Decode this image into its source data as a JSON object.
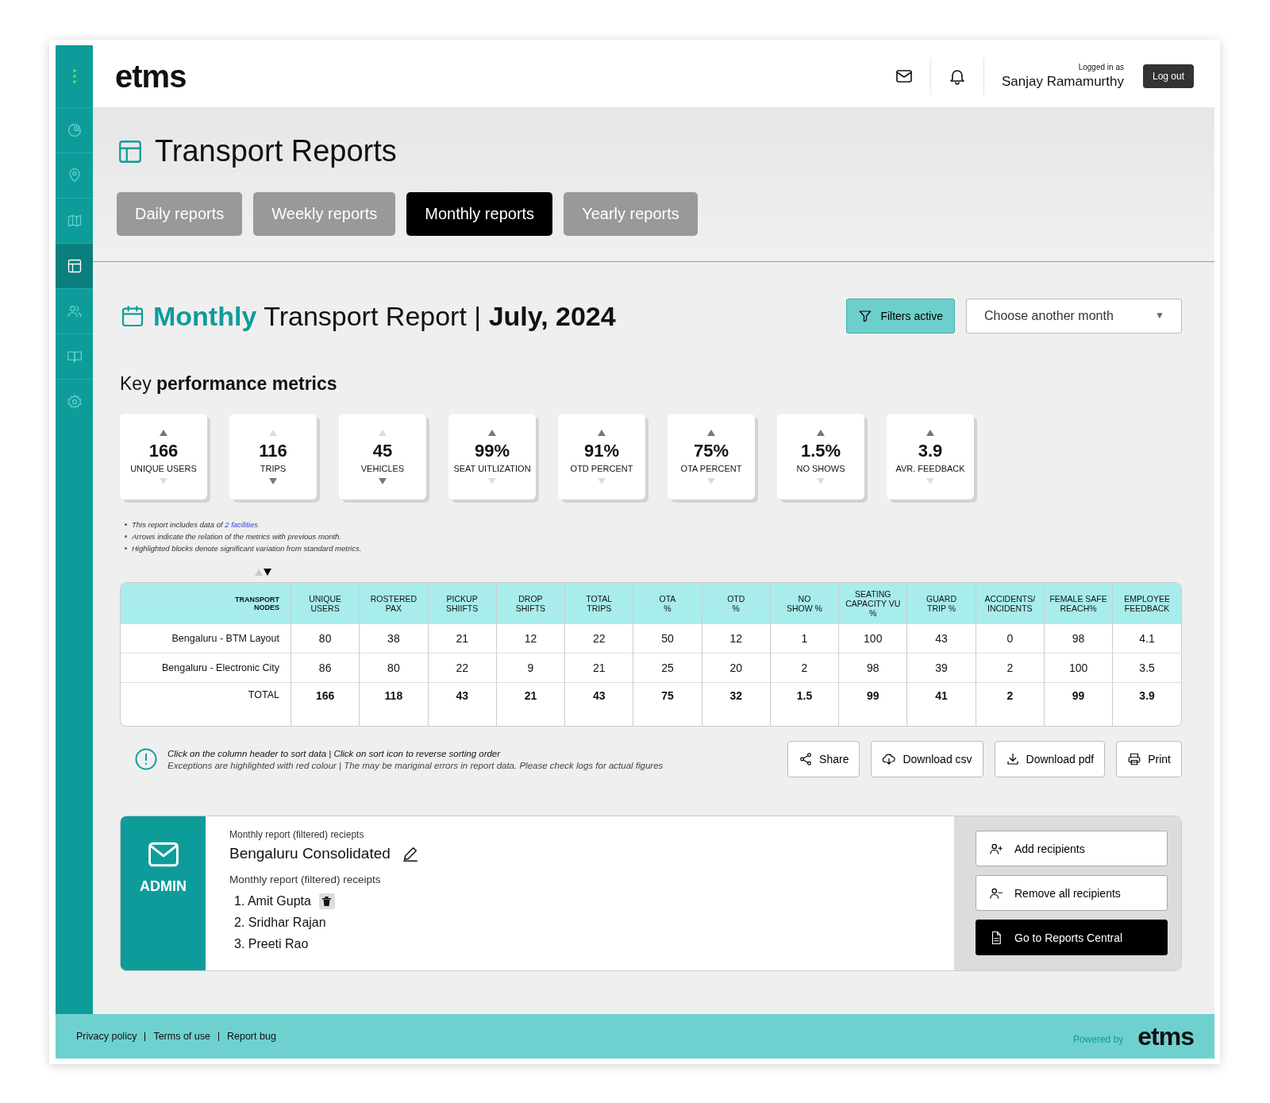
{
  "header": {
    "logo": "etms",
    "logged_in_label": "Logged in as",
    "user": "Sanjay Ramamurthy",
    "logout": "Log out"
  },
  "sidebar": {
    "items": [
      {
        "selected": false
      },
      {
        "selected": false
      },
      {
        "selected": false
      },
      {
        "selected": true
      },
      {
        "selected": false
      },
      {
        "selected": false
      },
      {
        "selected": false
      }
    ]
  },
  "page_title": "Transport Reports",
  "tabs": [
    {
      "label": "Daily reports",
      "selected": false
    },
    {
      "label": "Weekly reports",
      "selected": false
    },
    {
      "label": "Monthly reports",
      "selected": true
    },
    {
      "label": "Yearly reports",
      "selected": false
    }
  ],
  "report": {
    "title_highlight": "Monthly",
    "title_rest": "Transport Report |",
    "period": "July, 2024"
  },
  "filters_button": {
    "label": "Filters active",
    "active": true
  },
  "month_select": {
    "placeholder": "Choose another month",
    "caret": "▼"
  },
  "kpi_heading": "Key **performance metrics**",
  "kpis": [
    {
      "value": "166",
      "label": "UNIQUE USERS",
      "trend_up": true
    },
    {
      "value": "116",
      "label": "TRIPS",
      "trend_up": false
    },
    {
      "value": "45",
      "label": "VEHICLES",
      "trend_up": false
    },
    {
      "value": "99%",
      "label": "SEAT UITLIZATION",
      "trend_up": true
    },
    {
      "value": "91%",
      "label": "OTD PERCENT",
      "trend_up": true
    },
    {
      "value": "75%",
      "label": "OTA PERCENT",
      "trend_up": true
    },
    {
      "value": "1.5%",
      "label": "NO SHOWS",
      "trend_up": true
    },
    {
      "value": "3.9",
      "label": "AVR. FEEDBACK",
      "trend_up": true
    }
  ],
  "notes": [
    {
      "text": "This report includes data of ",
      "link": "2 facilities"
    },
    {
      "text": "Arrows indicate the relation of the metrics with previous month."
    },
    {
      "text": "Highlighted blocks denote significant variation from standard metrics."
    }
  ],
  "sort_descending": true,
  "table": {
    "columns": [
      "TRANSPORT\nNODES",
      "UNIQUE\nUSERS",
      "ROSTERED\nPAX",
      "PICKUP\nSHIIFTS",
      "DROP\nSHIFTS",
      "TOTAL\nTRIPS",
      "OTA\n%",
      "OTD\n%",
      "NO\nSHOW %",
      "SEATING\nCAPACITY VU %",
      "GUARD\nTRIP %",
      "ACCIDENTS/\nINCIDENTS",
      "FEMALE SAFE\nREACH%",
      "EMPLOYEE\nFEEDBACK"
    ],
    "rows": [
      {
        "kind": "data",
        "cells": [
          "Bengaluru - BTM Layout",
          "80",
          "38",
          "21",
          "12",
          "22",
          "50",
          "12",
          "1",
          "100",
          "43",
          "0",
          "98",
          "4.1"
        ]
      },
      {
        "kind": "data",
        "cells": [
          "Bengaluru - Electronic City",
          "86",
          "80",
          "22",
          "9",
          "21",
          "25",
          "20",
          "2",
          "98",
          "39",
          "2",
          "100",
          "3.5"
        ]
      },
      {
        "kind": "total",
        "cells": [
          "TOTAL",
          "166",
          "118",
          "43",
          "21",
          "43",
          "75",
          "32",
          "1.5",
          "99",
          "41",
          "2",
          "99",
          "3.9"
        ]
      }
    ]
  },
  "hint": {
    "line1": "Click on the column header to sort data | Click on sort icon to reverse sorting order",
    "line2": "Exceptions are highlighted with red colour | The may be mariginal errors in report data. Please check logs for actual figures"
  },
  "actions": [
    {
      "kind": "share",
      "label": "Share"
    },
    {
      "kind": "csv",
      "label": "Download csv"
    },
    {
      "kind": "pdf",
      "label": "Download pdf"
    },
    {
      "kind": "print",
      "label": "Print"
    }
  ],
  "admin": {
    "badge": "ADMIN",
    "caption": "Monthly report (filtered) reciepts",
    "name": "Bengaluru Consolidated",
    "list_label": "Monthly report (filtered) receipts",
    "recipients": [
      {
        "number": "1.",
        "name": "Amit Gupta",
        "deletable": true
      },
      {
        "number": "2.",
        "name": "Sridhar Rajan",
        "deletable": false
      },
      {
        "number": "3.",
        "name": "Preeti Rao",
        "deletable": false
      }
    ],
    "buttons": [
      {
        "kind": "add",
        "label": "Add recipients"
      },
      {
        "kind": "remove",
        "label": "Remove all recipients"
      },
      {
        "kind": "primary",
        "label": "Go to Reports Central"
      }
    ]
  },
  "footer": {
    "links": [
      "Privacy policy",
      "Terms of use",
      "Report bug"
    ],
    "powered_by": "Powered by",
    "logo": "etms"
  }
}
